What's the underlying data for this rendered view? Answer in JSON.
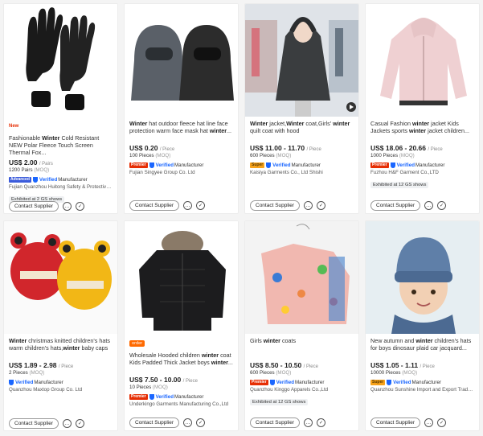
{
  "products": [
    {
      "tag": "New",
      "title_html": "Fashionable <b>Winter</b> Cold Resistant NEW Polar Fleece Touch Screen Thermal Fox...",
      "price": "US$ 2.00",
      "unit": "/ Pairs",
      "moq_qty": "1200 Pairs",
      "moq_label": "(MOQ)",
      "badge": "Advanced",
      "verified": "Verified",
      "mfr": "Manufacturer",
      "company": "Fujian Quanzhou Huitong Safety & Protective P...",
      "exhibit": "Exhibited at 2 GS shows",
      "contact_label": "Contact Supplier"
    },
    {
      "tag": "",
      "title_html": "<b>Winter</b> hat outdoor fleece hat line face protection warm face mask hat <b>winter</b>...",
      "price": "US$ 0.20",
      "unit": "/ Piece",
      "moq_qty": "100 Pieces",
      "moq_label": "(MOQ)",
      "badge": "Premier",
      "verified": "Verified",
      "mfr": "Manufacturer",
      "company": "Fujian Singyee Group Co. Ltd",
      "exhibit": "",
      "contact_label": "Contact Supplier"
    },
    {
      "tag": "",
      "title_html": "<b>Winter</b> jacket,<b>Winter</b> coat,Girls' <b>winter</b> quilt coat with hood",
      "price": "US$ 11.00 - 11.70",
      "unit": "/ Piece",
      "moq_qty": "600 Pieces",
      "moq_label": "(MOQ)",
      "badge": "Super",
      "verified": "Verified",
      "mfr": "Manufacturer",
      "company": "Kaisiya Garments Co., Ltd Shishi",
      "exhibit": "",
      "contact_label": "Contact Supplier"
    },
    {
      "tag": "",
      "title_html": "Casual Fashion <b>winter</b> jacket Kids Jackets sports <b>winter</b> jacket children...",
      "price": "US$ 18.06 - 20.66",
      "unit": "/ Piece",
      "moq_qty": "1000 Pieces",
      "moq_label": "(MOQ)",
      "badge": "Premier",
      "verified": "Verified",
      "mfr": "Manufacturer",
      "company": "Fuzhou H&F Garment Co.,LTD",
      "exhibit": "Exhibited at 12 GS shows",
      "contact_label": "Contact Supplier"
    },
    {
      "tag": "",
      "title_html": "<b>Winter</b> christmas knitted children's hats warm children's hats,<b>winter</b> baby caps",
      "price": "US$ 1.89 - 2.98",
      "unit": "/ Piece",
      "moq_qty": "2 Pieces",
      "moq_label": "(MOQ)",
      "badge": "",
      "verified": "Verified",
      "mfr": "Manufacturer",
      "company": "Quanzhou Maxtop Group Co. Ltd",
      "exhibit": "",
      "contact_label": "Contact Supplier"
    },
    {
      "tag": "order",
      "title_html": "Wholesale Hooded children <b>winter</b> coat Kids Padded Thick Jacket boys <b>winter</b>...",
      "price": "US$ 7.50 - 10.00",
      "unit": "/ Piece",
      "moq_qty": "10 Pieces",
      "moq_label": "(MOQ)",
      "badge": "Premier",
      "verified": "Verified",
      "mfr": "Manufacturer",
      "company": "Underkingo Garments Manufacturing Co.,Ltd",
      "exhibit": "",
      "contact_label": "Contact Supplier"
    },
    {
      "tag": "",
      "title_html": "Girls <b>winter</b> coats",
      "price": "US$ 8.50 - 10.50",
      "unit": "/ Piece",
      "moq_qty": "600 Pieces",
      "moq_label": "(MOQ)",
      "badge": "Premier",
      "verified": "Verified",
      "mfr": "Manufacturer",
      "company": "Quanzhou Kinggo Apparels Co.,Ltd",
      "exhibit": "Exhibited at 12 GS shows",
      "contact_label": "Contact Supplier"
    },
    {
      "tag": "",
      "title_html": "New autumn and <b>winter</b> children's hats for boys dinosaur plaid car jacquard...",
      "price": "US$ 1.05 - 1.11",
      "unit": "/ Piece",
      "moq_qty": "10000 Pieces",
      "moq_label": "(MOQ)",
      "badge": "Super",
      "verified": "Verified",
      "mfr": "Manufacturer",
      "company": "Quanzhou Sunshine Import and Export Trade G...",
      "exhibit": "",
      "contact_label": "Contact Supplier"
    }
  ],
  "colors": {
    "accent": "#ff6a00",
    "verified": "#1a66ff",
    "new_tag": "#e62e04"
  }
}
